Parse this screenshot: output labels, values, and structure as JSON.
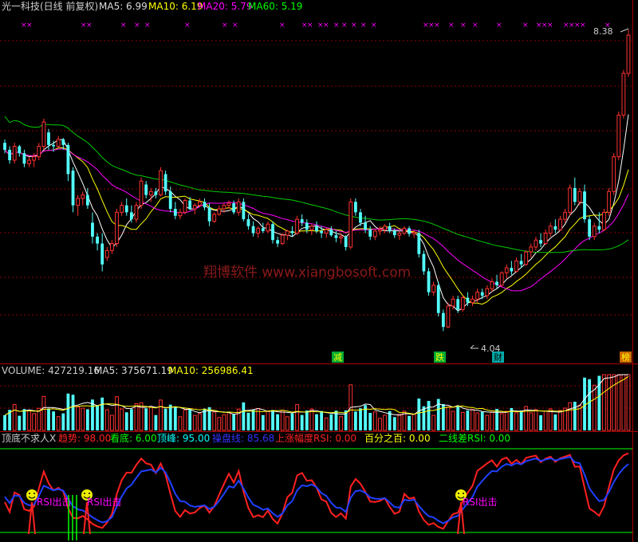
{
  "header": {
    "title": "光一科技(日线 前复权)",
    "ma5": "MA5: 6.99",
    "ma10": "MA10: 6.19",
    "ma20": "MA20: 5.79",
    "ma60": "MA60: 5.19"
  },
  "price_panel": {
    "high_label": "8.38",
    "low_label": "4.04",
    "watermark": "翔博软件 www.xiangbosoft.com",
    "signal_markers": [
      "减",
      "跌",
      "财",
      "榜"
    ]
  },
  "volume_panel": {
    "volume": "VOLUME: 427219.16",
    "ma5": "MA5: 375671.19",
    "ma10": "MA10: 256986.41"
  },
  "indicator_panel": {
    "name": "顶底不求人X",
    "trend": "趋势: 98.00",
    "bottom": "看底: 6.00",
    "peak": "顶峰: 95.00",
    "line": "操盘线: 85.68",
    "rise_rsi": "上涨幅度RSI: 0.00",
    "percent": "百分之百: 0.00",
    "two_line_rsi": "二线差RSI: 0.00",
    "signal_label": "RSI出击"
  },
  "chart_data": {
    "type": "candlestick",
    "candles": [
      [
        6.75,
        6.8,
        6.6,
        6.65
      ],
      [
        6.65,
        6.7,
        6.45,
        6.5
      ],
      [
        6.5,
        6.75,
        6.45,
        6.7
      ],
      [
        6.7,
        6.72,
        6.55,
        6.6
      ],
      [
        6.6,
        6.65,
        6.4,
        6.45
      ],
      [
        6.45,
        6.55,
        6.4,
        6.5
      ],
      [
        6.5,
        6.6,
        6.4,
        6.55
      ],
      [
        6.55,
        6.75,
        6.5,
        6.7
      ],
      [
        6.7,
        7.1,
        6.65,
        7.05
      ],
      [
        6.9,
        6.95,
        6.65,
        6.72
      ],
      [
        6.72,
        6.78,
        6.62,
        6.7
      ],
      [
        6.7,
        6.85,
        6.68,
        6.8
      ],
      [
        6.8,
        6.82,
        6.65,
        6.72
      ],
      [
        6.72,
        6.75,
        6.2,
        6.3
      ],
      [
        6.35,
        6.4,
        5.75,
        5.85
      ],
      [
        5.85,
        6.0,
        5.7,
        5.95
      ],
      [
        5.95,
        6.05,
        5.85,
        6.0
      ],
      [
        6.0,
        6.1,
        5.8,
        5.85
      ],
      [
        5.6,
        5.75,
        5.3,
        5.4
      ],
      [
        5.4,
        5.45,
        5.2,
        5.3
      ],
      [
        5.3,
        5.45,
        4.9,
        5.0
      ],
      [
        5.1,
        5.25,
        5.05,
        5.2
      ],
      [
        5.2,
        5.35,
        5.15,
        5.3
      ],
      [
        5.3,
        5.8,
        5.25,
        5.75
      ],
      [
        5.75,
        5.9,
        5.7,
        5.85
      ],
      [
        5.85,
        5.95,
        5.7,
        5.75
      ],
      [
        5.75,
        5.85,
        5.6,
        5.65
      ],
      [
        5.65,
        5.9,
        5.6,
        5.85
      ],
      [
        5.85,
        6.25,
        5.8,
        6.2
      ],
      [
        6.15,
        6.2,
        5.95,
        6.0
      ],
      [
        6.0,
        6.1,
        5.9,
        6.05
      ],
      [
        6.05,
        6.1,
        5.95,
        6.0
      ],
      [
        6.0,
        6.4,
        5.98,
        6.35
      ],
      [
        6.3,
        6.35,
        6.0,
        6.05
      ],
      [
        6.05,
        6.12,
        5.75,
        5.8
      ],
      [
        5.8,
        5.9,
        5.65,
        5.7
      ],
      [
        5.7,
        5.8,
        5.65,
        5.75
      ],
      [
        5.75,
        5.95,
        5.72,
        5.92
      ],
      [
        5.92,
        5.97,
        5.78,
        5.8
      ],
      [
        5.8,
        5.88,
        5.72,
        5.85
      ],
      [
        5.85,
        5.95,
        5.82,
        5.9
      ],
      [
        5.9,
        5.95,
        5.78,
        5.82
      ],
      [
        5.82,
        5.88,
        5.55,
        5.62
      ],
      [
        5.62,
        5.75,
        5.6,
        5.72
      ],
      [
        5.72,
        5.85,
        5.7,
        5.8
      ],
      [
        5.8,
        5.88,
        5.74,
        5.85
      ],
      [
        5.85,
        5.92,
        5.8,
        5.88
      ],
      [
        5.88,
        5.92,
        5.72,
        5.75
      ],
      [
        5.75,
        5.95,
        5.7,
        5.9
      ],
      [
        5.9,
        5.95,
        5.62,
        5.65
      ],
      [
        5.65,
        5.72,
        5.5,
        5.55
      ],
      [
        5.55,
        5.62,
        5.4,
        5.45
      ],
      [
        5.45,
        5.55,
        5.38,
        5.52
      ],
      [
        5.52,
        5.6,
        5.45,
        5.48
      ],
      [
        5.48,
        5.62,
        5.45,
        5.58
      ],
      [
        5.58,
        5.62,
        5.3,
        5.35
      ],
      [
        5.35,
        5.4,
        5.25,
        5.3
      ],
      [
        5.3,
        5.45,
        5.28,
        5.42
      ],
      [
        5.42,
        5.5,
        5.35,
        5.48
      ],
      [
        5.48,
        5.55,
        5.4,
        5.45
      ],
      [
        5.45,
        5.7,
        5.42,
        5.65
      ],
      [
        5.65,
        5.72,
        5.55,
        5.6
      ],
      [
        5.6,
        5.65,
        5.45,
        5.5
      ],
      [
        5.5,
        5.58,
        5.42,
        5.55
      ],
      [
        5.55,
        5.62,
        5.45,
        5.48
      ],
      [
        5.48,
        5.55,
        5.38,
        5.45
      ],
      [
        5.45,
        5.52,
        5.38,
        5.5
      ],
      [
        5.5,
        5.55,
        5.4,
        5.42
      ],
      [
        5.42,
        5.48,
        5.32,
        5.38
      ],
      [
        5.38,
        5.45,
        5.3,
        5.4
      ],
      [
        5.4,
        5.42,
        5.2,
        5.25
      ],
      [
        5.25,
        5.95,
        5.22,
        5.9
      ],
      [
        5.9,
        5.95,
        5.7,
        5.75
      ],
      [
        5.75,
        5.8,
        5.55,
        5.6
      ],
      [
        5.6,
        5.7,
        5.45,
        5.5
      ],
      [
        5.5,
        5.55,
        5.35,
        5.4
      ],
      [
        5.4,
        5.5,
        5.35,
        5.48
      ],
      [
        5.48,
        5.55,
        5.42,
        5.5
      ],
      [
        5.5,
        5.58,
        5.45,
        5.55
      ],
      [
        5.55,
        5.6,
        5.45,
        5.48
      ],
      [
        5.48,
        5.52,
        5.38,
        5.42
      ],
      [
        5.42,
        5.48,
        5.35,
        5.45
      ],
      [
        5.45,
        5.55,
        5.42,
        5.52
      ],
      [
        5.52,
        5.55,
        5.4,
        5.44
      ],
      [
        5.44,
        5.5,
        5.38,
        5.46
      ],
      [
        5.45,
        5.5,
        5.1,
        5.15
      ],
      [
        5.15,
        5.2,
        4.85,
        4.9
      ],
      [
        4.9,
        4.95,
        4.55,
        4.6
      ],
      [
        4.6,
        4.75,
        4.55,
        4.7
      ],
      [
        4.7,
        4.75,
        4.25,
        4.3
      ],
      [
        4.3,
        4.35,
        4.04,
        4.1
      ],
      [
        4.1,
        4.45,
        4.08,
        4.4
      ],
      [
        4.4,
        4.55,
        4.35,
        4.5
      ],
      [
        4.5,
        4.55,
        4.3,
        4.35
      ],
      [
        4.35,
        4.55,
        4.32,
        4.52
      ],
      [
        4.52,
        4.6,
        4.4,
        4.45
      ],
      [
        4.45,
        4.55,
        4.4,
        4.5
      ],
      [
        4.5,
        4.65,
        4.45,
        4.6
      ],
      [
        4.6,
        4.65,
        4.5,
        4.55
      ],
      [
        4.55,
        4.7,
        4.5,
        4.65
      ],
      [
        4.65,
        4.8,
        4.6,
        4.75
      ],
      [
        4.75,
        4.85,
        4.65,
        4.7
      ],
      [
        4.7,
        4.9,
        4.68,
        4.88
      ],
      [
        4.88,
        5.0,
        4.8,
        4.95
      ],
      [
        4.95,
        5.05,
        4.85,
        4.9
      ],
      [
        4.9,
        5.1,
        4.88,
        5.05
      ],
      [
        5.05,
        5.15,
        4.95,
        5.0
      ],
      [
        5.0,
        5.2,
        4.98,
        5.18
      ],
      [
        5.18,
        5.3,
        5.1,
        5.25
      ],
      [
        5.25,
        5.4,
        5.2,
        5.35
      ],
      [
        5.35,
        5.45,
        5.25,
        5.3
      ],
      [
        5.3,
        5.5,
        5.28,
        5.45
      ],
      [
        5.45,
        5.6,
        5.4,
        5.55
      ],
      [
        5.55,
        5.65,
        5.45,
        5.5
      ],
      [
        5.5,
        5.7,
        5.48,
        5.65
      ],
      [
        5.65,
        5.8,
        5.6,
        5.75
      ],
      [
        5.75,
        6.15,
        5.7,
        6.1
      ],
      [
        6.1,
        6.25,
        5.85,
        5.9
      ],
      [
        5.9,
        6.1,
        5.85,
        6.05
      ],
      [
        6.05,
        6.15,
        5.6,
        5.65
      ],
      [
        5.65,
        5.7,
        5.35,
        5.4
      ],
      [
        5.4,
        5.6,
        5.35,
        5.55
      ],
      [
        5.55,
        5.75,
        5.45,
        5.5
      ],
      [
        5.5,
        5.8,
        5.48,
        5.75
      ],
      [
        5.75,
        6.1,
        5.7,
        6.05
      ],
      [
        6.05,
        6.6,
        6.0,
        6.55
      ],
      [
        6.55,
        7.2,
        6.5,
        7.15
      ],
      [
        7.15,
        7.8,
        7.1,
        7.75
      ],
      [
        7.75,
        8.38,
        7.7,
        8.3
      ]
    ],
    "volume_series": [
      "VOLUME",
      "MA5",
      "MA10"
    ],
    "indicator_series": [
      "趋势",
      "操盘线"
    ]
  }
}
